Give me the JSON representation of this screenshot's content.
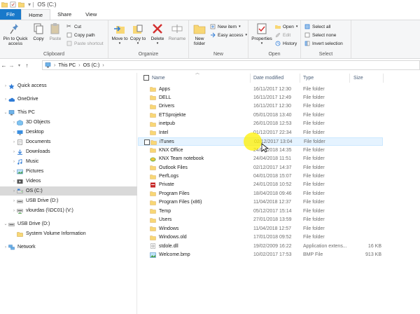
{
  "window": {
    "title": "OS (C:)"
  },
  "tabs": [
    {
      "label": "File"
    },
    {
      "label": "Home"
    },
    {
      "label": "Share"
    },
    {
      "label": "View"
    }
  ],
  "ribbon": {
    "clipboard": {
      "label": "Clipboard",
      "pin": "Pin to Quick access",
      "copy": "Copy",
      "paste": "Paste",
      "cut": "Cut",
      "copy_path": "Copy path",
      "paste_shortcut": "Paste shortcut"
    },
    "organize": {
      "label": "Organize",
      "move_to": "Move to",
      "copy_to": "Copy to",
      "delete": "Delete",
      "rename": "Rename"
    },
    "new": {
      "label": "New",
      "new_folder": "New folder",
      "new_item": "New item",
      "easy_access": "Easy access"
    },
    "open": {
      "label": "Open",
      "properties": "Properties",
      "open": "Open",
      "edit": "Edit",
      "history": "History"
    },
    "select": {
      "label": "Select",
      "select_all": "Select all",
      "select_none": "Select none",
      "invert_selection": "Invert selection"
    }
  },
  "address": {
    "crumbs": [
      "This PC",
      "OS (C:)"
    ]
  },
  "nav": {
    "items": [
      {
        "label": "Quick access",
        "icon": "star-icon"
      },
      {
        "label": "OneDrive",
        "icon": "cloud-icon"
      },
      {
        "label": "This PC",
        "icon": "computer-icon"
      },
      {
        "label": "3D Objects",
        "icon": "cube-icon"
      },
      {
        "label": "Desktop",
        "icon": "desktop-icon"
      },
      {
        "label": "Documents",
        "icon": "documents-icon"
      },
      {
        "label": "Downloads",
        "icon": "downloads-icon"
      },
      {
        "label": "Music",
        "icon": "music-icon"
      },
      {
        "label": "Pictures",
        "icon": "pictures-icon"
      },
      {
        "label": "Videos",
        "icon": "videos-icon"
      },
      {
        "label": "OS (C:)",
        "icon": "drive-icon"
      },
      {
        "label": "USB Drive (D:)",
        "icon": "usb-drive-icon"
      },
      {
        "label": "vlourdas (\\\\DC01) (V:)",
        "icon": "network-drive-icon"
      },
      {
        "label": "USB Drive (D:)",
        "icon": "usb-drive-icon"
      },
      {
        "label": "System Volume Information",
        "icon": "folder-icon"
      },
      {
        "label": "Network",
        "icon": "network-icon"
      }
    ]
  },
  "columns": {
    "name": "Name",
    "date": "Date modified",
    "type": "Type",
    "size": "Size"
  },
  "files": [
    {
      "name": "Apps",
      "date": "16/11/2017 12:30",
      "type": "File folder",
      "size": "",
      "icon": "folder-icon"
    },
    {
      "name": "DELL",
      "date": "16/11/2017 12:49",
      "type": "File folder",
      "size": "",
      "icon": "folder-icon"
    },
    {
      "name": "Drivers",
      "date": "16/11/2017 12:30",
      "type": "File folder",
      "size": "",
      "icon": "folder-icon"
    },
    {
      "name": "ETSprojekte",
      "date": "05/01/2018 13:40",
      "type": "File folder",
      "size": "",
      "icon": "folder-icon"
    },
    {
      "name": "inetpub",
      "date": "26/01/2018 12:53",
      "type": "File folder",
      "size": "",
      "icon": "folder-icon"
    },
    {
      "name": "Intel",
      "date": "01/12/2017 22:34",
      "type": "File folder",
      "size": "",
      "icon": "folder-icon"
    },
    {
      "name": "iTunes",
      "date": "02/12/2017 13:04",
      "type": "File folder",
      "size": "",
      "icon": "folder-icon"
    },
    {
      "name": "KNX Office",
      "date": "24/04/2018 14:35",
      "type": "File folder",
      "size": "",
      "icon": "folder-icon"
    },
    {
      "name": "KNX Team notebook",
      "date": "24/04/2018 11:51",
      "type": "File folder",
      "size": "",
      "icon": "notebook-icon"
    },
    {
      "name": "Outlook Files",
      "date": "02/12/2017 14:37",
      "type": "File folder",
      "size": "",
      "icon": "folder-icon"
    },
    {
      "name": "PerfLogs",
      "date": "04/01/2018 15:07",
      "type": "File folder",
      "size": "",
      "icon": "folder-icon"
    },
    {
      "name": "Private",
      "date": "24/01/2018 10:52",
      "type": "File folder",
      "size": "",
      "icon": "private-folder-icon"
    },
    {
      "name": "Program Files",
      "date": "18/04/2018 09:46",
      "type": "File folder",
      "size": "",
      "icon": "folder-icon"
    },
    {
      "name": "Program Files (x86)",
      "date": "11/04/2018 12:37",
      "type": "File folder",
      "size": "",
      "icon": "folder-icon"
    },
    {
      "name": "Temp",
      "date": "05/12/2017 15:14",
      "type": "File folder",
      "size": "",
      "icon": "folder-icon"
    },
    {
      "name": "Users",
      "date": "27/01/2018 13:59",
      "type": "File folder",
      "size": "",
      "icon": "folder-icon"
    },
    {
      "name": "Windows",
      "date": "11/04/2018 12:57",
      "type": "File folder",
      "size": "",
      "icon": "folder-icon"
    },
    {
      "name": "Windows.old",
      "date": "17/01/2018 09:52",
      "type": "File folder",
      "size": "",
      "icon": "folder-icon"
    },
    {
      "name": "stdole.dll",
      "date": "19/02/2009 16:22",
      "type": "Application extens...",
      "size": "16 KB",
      "icon": "dll-file-icon"
    },
    {
      "name": "Welcome.bmp",
      "date": "10/02/2017 17:53",
      "type": "BMP File",
      "size": "913 KB",
      "icon": "bmp-file-icon"
    }
  ],
  "colors": {
    "accent": "#1979ca",
    "folder": "#f8d775",
    "folder_dark": "#dcb067",
    "hover_row": "#e5f3ff",
    "selected_nav": "#d9d9d9",
    "cursor_highlight": "#fff000"
  }
}
